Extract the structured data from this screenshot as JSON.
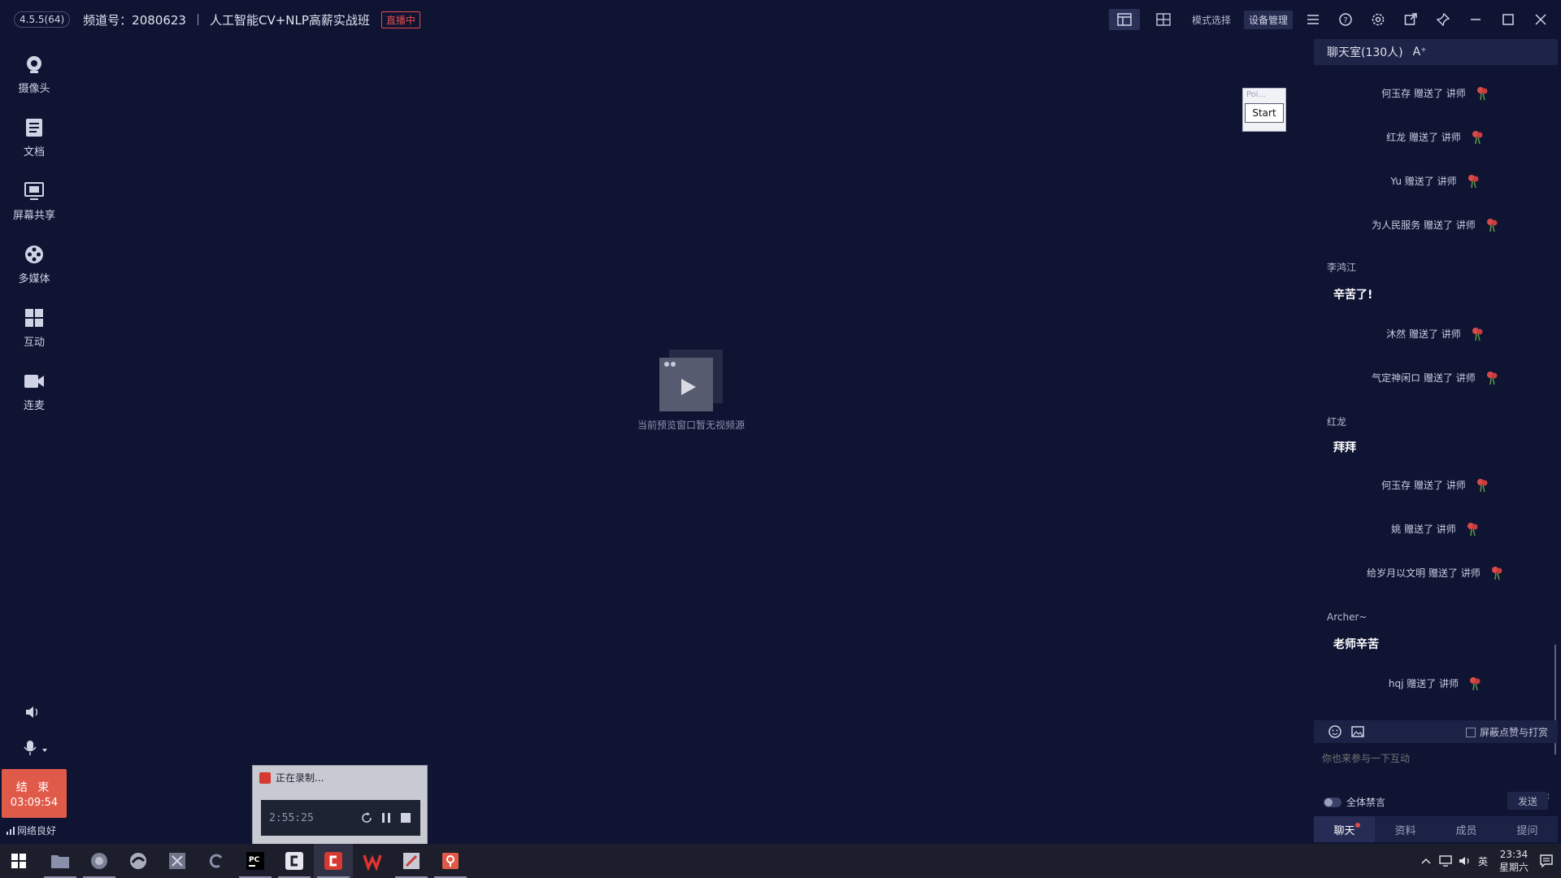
{
  "topbar": {
    "version": "4.5.5(64)",
    "channel_label": "频道号：2080623",
    "course_title": "人工智能CV+NLP高薪实战班",
    "live_badge": "直播中",
    "mode_select_label": "模式选择",
    "device_manage_label": "设备管理"
  },
  "sidebar": {
    "items": [
      {
        "label": "摄像头",
        "icon": "camera-icon"
      },
      {
        "label": "文档",
        "icon": "document-icon"
      },
      {
        "label": "屏幕共享",
        "icon": "screen-share-icon"
      },
      {
        "label": "多媒体",
        "icon": "multimedia-icon"
      },
      {
        "label": "互动",
        "icon": "interaction-icon"
      },
      {
        "label": "连麦",
        "icon": "video-call-icon"
      }
    ],
    "end_button": {
      "label": "结 束",
      "timer": "03:09:54"
    },
    "network_status": "网络良好"
  },
  "center": {
    "placeholder_text": "当前预览窗口暂无视频源"
  },
  "poi_widget": {
    "label": "Poi...",
    "start_label": "Start"
  },
  "chat": {
    "header_title": "聊天室(130人)",
    "font_size_label": "A⁺",
    "gifts": [
      {
        "text": "何玉存 赠送了 讲师"
      },
      {
        "text": "红龙 赠送了 讲师"
      },
      {
        "text": "Yu 赠送了 讲师"
      },
      {
        "text": "为人民服务 赠送了 讲师"
      },
      {
        "text": "沐然 赠送了 讲师"
      },
      {
        "text": "气定神闲ロ 赠送了 讲师"
      },
      {
        "text": "何玉存 赠送了 讲师"
      },
      {
        "text": "姚 赠送了 讲师"
      },
      {
        "text": "给岁月以文明 赠送了 讲师"
      },
      {
        "text": "hqj 赠送了 讲师"
      }
    ],
    "messages": [
      {
        "user": "李鸿江",
        "text": "辛苦了!"
      },
      {
        "user": "红龙",
        "text": "拜拜"
      },
      {
        "user": "Archer~",
        "text": "老师辛苦"
      }
    ],
    "hide_gifts_label": "屏蔽点赞与打赏",
    "input_placeholder": "你也来参与一下互动",
    "mute_all_label": "全体禁言",
    "send_label": "发送",
    "tabs": [
      "聊天",
      "资料",
      "成员",
      "提问"
    ]
  },
  "recording": {
    "title": "正在录制...",
    "time": "2:55:25"
  },
  "taskbar": {
    "time": "23:34",
    "day": "星期六",
    "ime": "英"
  },
  "colors": {
    "background": "#0f1433",
    "accent_red": "#e05a4a",
    "live_badge_red": "#e34b4b"
  }
}
